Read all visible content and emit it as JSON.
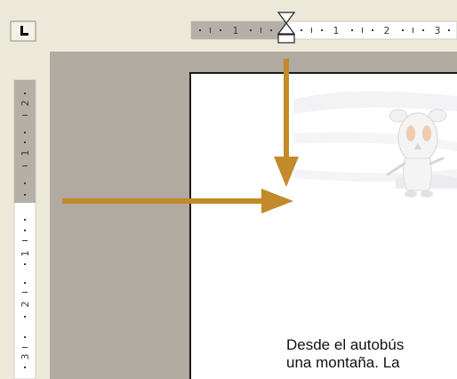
{
  "ruler": {
    "tab_selector_icon": "left-tab-stop-icon",
    "horizontal_labels": [
      "1",
      "1",
      "2",
      "3"
    ],
    "vertical_labels": [
      "2",
      "1",
      "1",
      "2",
      "3"
    ]
  },
  "document": {
    "illustration": "cartoon-character",
    "lines": [
      "Desde el autobús",
      "una montaña. La"
    ]
  },
  "annotations": {
    "arrow_color": "#c28a2a"
  },
  "colors": {
    "workspace": "#b0aaa0",
    "ruler_margin": "#b4b0a7",
    "ruler_body": "#ffffff",
    "chrome": "#ece9d8",
    "page": "#ffffff",
    "page_border": "#1a1a1a"
  }
}
